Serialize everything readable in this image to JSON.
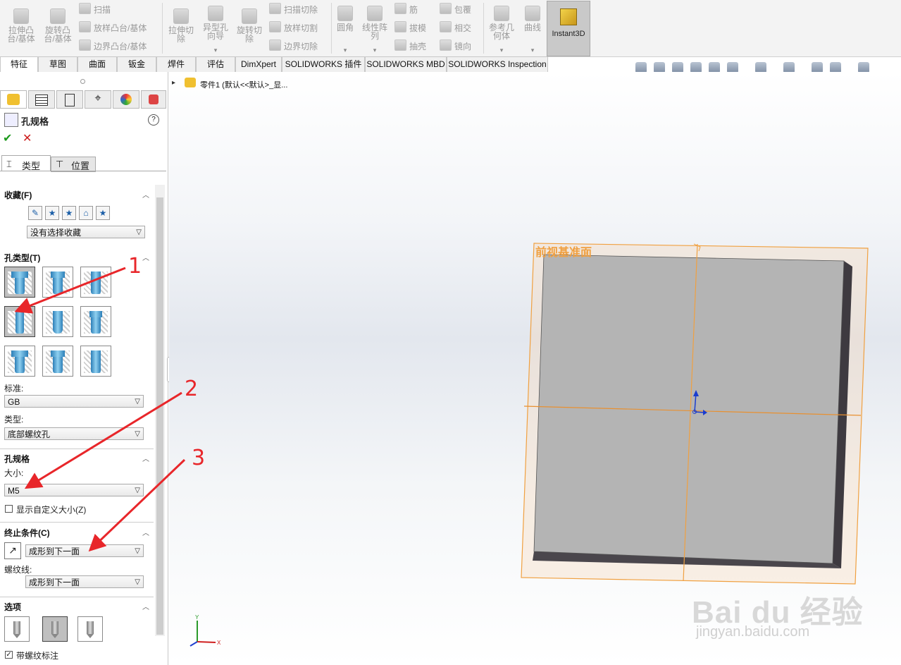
{
  "ribbon": {
    "extrude_boss": "拉伸凸\n台/基体",
    "revolve_boss": "旋转凸\n台/基体",
    "sweep": "扫描",
    "loft_boss": "放样凸台/基体",
    "boundary_boss": "边界凸台/基体",
    "extrude_cut": "拉伸切\n除",
    "hole_wizard": "异型孔\n向导",
    "revolve_cut": "旋转切\n除",
    "swept_cut": "扫描切除",
    "lofted_cut": "放样切割",
    "boundary_cut": "边界切除",
    "fillet": "圆角",
    "linear_pattern": "线性阵\n列",
    "rib": "筋",
    "draft": "拔模",
    "shell": "抽壳",
    "wrap": "包覆",
    "intersect": "相交",
    "mirror": "镜向",
    "ref_geometry": "参考几\n何体",
    "curves": "曲线",
    "instant3d": "Instant3D"
  },
  "tabs": [
    "特征",
    "草图",
    "曲面",
    "钣金",
    "焊件",
    "评估",
    "DimXpert",
    "SOLIDWORKS 插件",
    "SOLIDWORKS MBD",
    "SOLIDWORKS Inspection"
  ],
  "panel": {
    "title": "孔规格",
    "help": "?",
    "ok": "✔",
    "cancel": "✕",
    "subtab_type": "类型",
    "subtab_position": "位置",
    "favorites_header": "收藏(F)",
    "favorites_value": "没有选择收藏",
    "hole_type_header": "孔类型(T)",
    "standard_label": "标准:",
    "standard_value": "GB",
    "type_label": "类型:",
    "type_value": "底部螺纹孔",
    "hole_spec_header": "孔规格",
    "size_label": "大小:",
    "size_value": "M5",
    "show_custom_size": "显示自定义大小(Z)",
    "end_condition_header": "终止条件(C)",
    "end_condition_value": "成形到下一面",
    "thread_label": "螺纹线:",
    "thread_value": "成形到下一面",
    "options_header": "选项",
    "cosmetic_thread": "带螺纹标注"
  },
  "tree": {
    "part_label": "零件1 (默认<<默认>_显..."
  },
  "viewport": {
    "plane_label": "前视基准面",
    "triad_x": "X",
    "triad_y": "Y"
  },
  "annotations": [
    "1",
    "2",
    "3"
  ],
  "watermark": {
    "brand": "Bai du 经验",
    "url": "jingyan.baidu.com"
  },
  "colors": {
    "plane_orange": "#f0a040",
    "arrow_red": "#e8262a",
    "part_gray": "#b4b4b4"
  }
}
